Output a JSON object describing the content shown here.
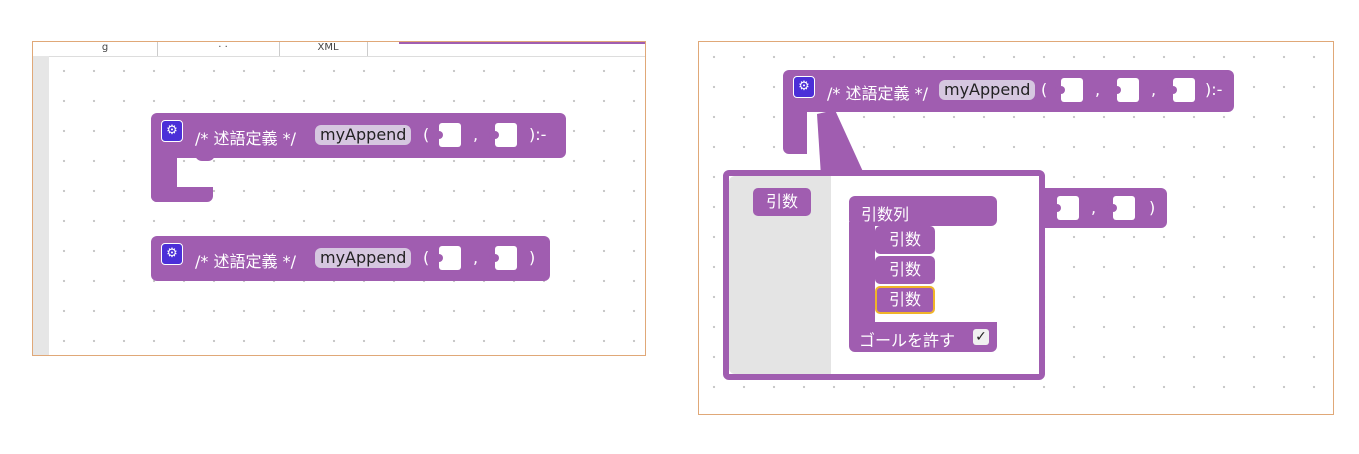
{
  "left_panel": {
    "tabs": [
      "g",
      "· ·",
      "XML"
    ],
    "block1": {
      "gear": "⚙",
      "prefix": "/* 述語定義 */",
      "name": "myAppend",
      "open_paren": "(",
      "comma": ",",
      "suffix": "):-"
    },
    "block2": {
      "gear": "⚙",
      "prefix": "/* 述語定義 */",
      "name": "myAppend",
      "open_paren": "(",
      "comma": ",",
      "suffix": ")"
    }
  },
  "right_panel": {
    "block1": {
      "gear": "⚙",
      "prefix": "/* 述語定義 */",
      "name": "myAppend",
      "open_paren": "(",
      "comma1": ",",
      "comma2": ",",
      "suffix": "):-"
    },
    "block2": {
      "comma": ",",
      "suffix": ")"
    },
    "mutator": {
      "toolbox_item": "引数",
      "container_label": "引数列",
      "items": [
        "引数",
        "引数",
        "引数"
      ],
      "goal_label": "ゴールを許す",
      "goal_checked": "✓"
    }
  },
  "colors": {
    "block": "#a05db0",
    "field": "#d6c7e0",
    "gear_bg": "#4b2fd8",
    "selected_outline": "#f0b429",
    "panel_border": "#e0a878"
  }
}
